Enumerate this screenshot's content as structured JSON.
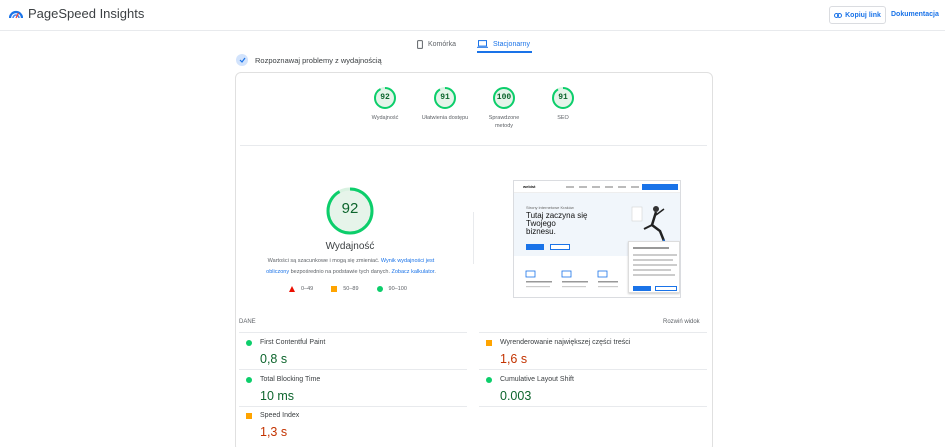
{
  "app": {
    "title": "PageSpeed Insights",
    "copy_link": "Kopiuj link",
    "docs": "Dokumentacja",
    "logo_icon": "pagespeed-gauge-icon",
    "colors": {
      "accent": "#1a73e8",
      "pass": "#0cce6b",
      "average": "#ffa400",
      "fail": "#eb0f00"
    }
  },
  "tabs": [
    {
      "label": "Komórka",
      "icon": "smartphone-icon",
      "selected": false
    },
    {
      "label": "Stacjonarny",
      "icon": "laptop-icon",
      "selected": true
    }
  ],
  "toggle": {
    "label": "Rozpoznawaj problemy z wydajnością",
    "checked": true
  },
  "scores": [
    {
      "value": 92,
      "label": "Wydajność"
    },
    {
      "value": 91,
      "label": "Ułatwienia dostępu"
    },
    {
      "value": 100,
      "label": "Sprawdzone metody"
    },
    {
      "value": 91,
      "label": "SEO"
    }
  ],
  "performance": {
    "score": 92,
    "title": "Wydajność",
    "description_pre": "Wartości są szacunkowe i mogą się zmieniać. ",
    "description_link1": "Wynik wydajności jest obliczony",
    "description_mid": " bezpośrednio na podstawie tych danych. ",
    "description_link2": "Zobacz kalkulator",
    "description_post": "."
  },
  "legend": [
    {
      "shape": "triangle",
      "label": "0–49"
    },
    {
      "shape": "square",
      "label": "50–89"
    },
    {
      "shape": "circle",
      "label": "90–100"
    }
  ],
  "screenshot": {
    "logo": "webist",
    "small_text": "Strony internetowe Kraków",
    "headline": "Tutaj zaczyna się Twojego biznesu.",
    "headline_line1": "Tutaj zaczyna się",
    "headline_line2": "Twojego",
    "headline_line3": "biznesu."
  },
  "data": {
    "heading": "DANE",
    "expand_label": "Rozwiń widok",
    "metrics": [
      {
        "name": "First Contentful Paint",
        "value": "0,8 s",
        "status": "pass"
      },
      {
        "name": "Wyrenderowanie największej części treści",
        "value": "1,6 s",
        "status": "average"
      },
      {
        "name": "Total Blocking Time",
        "value": "10 ms",
        "status": "pass"
      },
      {
        "name": "Cumulative Layout Shift",
        "value": "0.003",
        "status": "pass"
      },
      {
        "name": "Speed Index",
        "value": "1,3 s",
        "status": "average"
      }
    ]
  }
}
